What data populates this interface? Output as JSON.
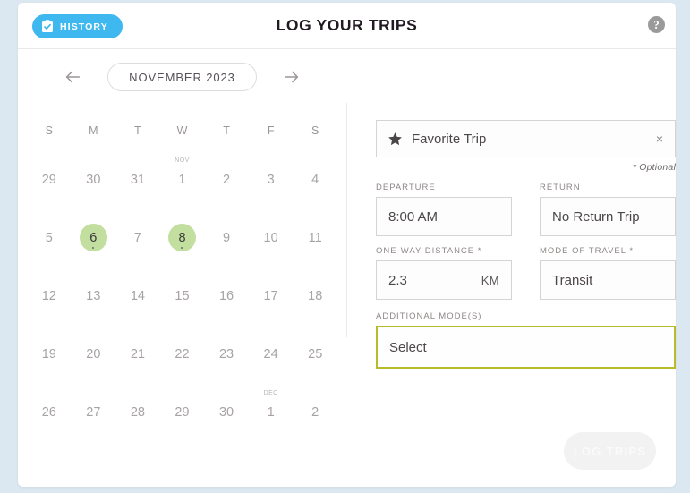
{
  "theme": {
    "page_background": "#dce8f1",
    "card_background": "#ffffff",
    "accent_blue": "#3fb8ef",
    "selected_date_green": "#c2df9f",
    "focus_border_olive": "#b8bb2a",
    "muted_text": "#9b9699"
  },
  "header": {
    "history_button_label": "HISTORY",
    "history_icon": "clipboard-check-icon",
    "title": "LOG YOUR TRIPS",
    "help_icon": "help-circle-icon",
    "help_glyph": "?"
  },
  "calendar": {
    "prev_icon": "arrow-left-icon",
    "next_icon": "arrow-right-icon",
    "month_label": "NOVEMBER 2023",
    "weekdays": [
      "S",
      "M",
      "T",
      "W",
      "T",
      "F",
      "S"
    ],
    "days": [
      {
        "day": "29",
        "tag": "",
        "selected": false
      },
      {
        "day": "30",
        "tag": "",
        "selected": false
      },
      {
        "day": "31",
        "tag": "",
        "selected": false
      },
      {
        "day": "1",
        "tag": "NOV",
        "selected": false
      },
      {
        "day": "2",
        "tag": "",
        "selected": false
      },
      {
        "day": "3",
        "tag": "",
        "selected": false
      },
      {
        "day": "4",
        "tag": "",
        "selected": false
      },
      {
        "day": "5",
        "tag": "",
        "selected": false
      },
      {
        "day": "6",
        "tag": "",
        "selected": true
      },
      {
        "day": "7",
        "tag": "",
        "selected": false
      },
      {
        "day": "8",
        "tag": "",
        "selected": true
      },
      {
        "day": "9",
        "tag": "",
        "selected": false
      },
      {
        "day": "10",
        "tag": "",
        "selected": false
      },
      {
        "day": "11",
        "tag": "",
        "selected": false
      },
      {
        "day": "12",
        "tag": "",
        "selected": false
      },
      {
        "day": "13",
        "tag": "",
        "selected": false
      },
      {
        "day": "14",
        "tag": "",
        "selected": false
      },
      {
        "day": "15",
        "tag": "",
        "selected": false
      },
      {
        "day": "16",
        "tag": "",
        "selected": false
      },
      {
        "day": "17",
        "tag": "",
        "selected": false
      },
      {
        "day": "18",
        "tag": "",
        "selected": false
      },
      {
        "day": "19",
        "tag": "",
        "selected": false
      },
      {
        "day": "20",
        "tag": "",
        "selected": false
      },
      {
        "day": "21",
        "tag": "",
        "selected": false
      },
      {
        "day": "22",
        "tag": "",
        "selected": false
      },
      {
        "day": "23",
        "tag": "",
        "selected": false
      },
      {
        "day": "24",
        "tag": "",
        "selected": false
      },
      {
        "day": "25",
        "tag": "",
        "selected": false
      },
      {
        "day": "26",
        "tag": "",
        "selected": false
      },
      {
        "day": "27",
        "tag": "",
        "selected": false
      },
      {
        "day": "28",
        "tag": "",
        "selected": false
      },
      {
        "day": "29",
        "tag": "",
        "selected": false
      },
      {
        "day": "30",
        "tag": "",
        "selected": false
      },
      {
        "day": "1",
        "tag": "DEC",
        "selected": false
      },
      {
        "day": "2",
        "tag": "",
        "selected": false
      }
    ]
  },
  "form": {
    "favorite": {
      "icon": "star-icon",
      "placeholder": "Favorite Trip",
      "value": "Favorite Trip",
      "clear_glyph": "×",
      "optional_note": "* Optional"
    },
    "departure": {
      "label": "DEPARTURE",
      "value": "8:00 AM"
    },
    "return": {
      "label": "RETURN",
      "value": "No Return Trip"
    },
    "distance": {
      "label": "ONE-WAY DISTANCE *",
      "value": "2.3",
      "unit": "KM"
    },
    "mode_of_travel": {
      "label": "MODE OF TRAVEL *",
      "value": "Transit"
    },
    "additional_modes": {
      "label": "ADDITIONAL MODE(S)",
      "value": "Select"
    },
    "submit_label": "LOG TRIPS"
  }
}
